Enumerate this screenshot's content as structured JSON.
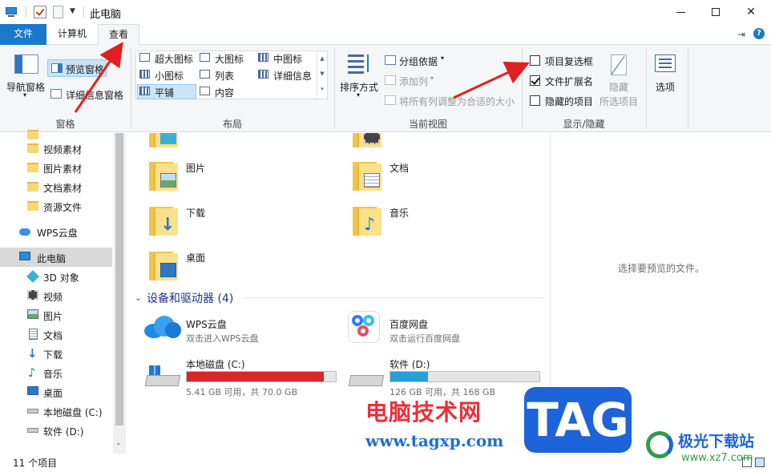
{
  "titlebar": {
    "title": "此电脑"
  },
  "tabs": {
    "file": "文件",
    "computer": "计算机",
    "view": "查看"
  },
  "ribbon": {
    "pane": {
      "group_label": "窗格",
      "nav_pane": "导航窗格",
      "preview_pane": "预览窗格",
      "details_pane": "详细信息窗格"
    },
    "layout": {
      "group_label": "布局",
      "options": [
        "超大图标",
        "大图标",
        "中图标",
        "小图标",
        "列表",
        "详细信息",
        "平铺",
        "内容"
      ],
      "selected": "平铺"
    },
    "current_view": {
      "group_label": "当前视图",
      "sort_by": "排序方式",
      "group_by": "分组依据",
      "add_column": "添加列",
      "size_all_columns": "将所有列调整为合适的大小"
    },
    "show_hide": {
      "group_label": "显示/隐藏",
      "item_checkboxes": {
        "label": "项目复选框",
        "checked": false
      },
      "file_extensions": {
        "label": "文件扩展名",
        "checked": true
      },
      "hidden_items": {
        "label": "隐藏的项目",
        "checked": false
      },
      "hide_selected_line1": "隐藏",
      "hide_selected_line2": "所选项目"
    },
    "options": "选项"
  },
  "nav_pane": {
    "items": [
      {
        "label": "视频素材",
        "icon": "folder-icon"
      },
      {
        "label": "图片素材",
        "icon": "folder-icon"
      },
      {
        "label": "文档素材",
        "icon": "folder-icon"
      },
      {
        "label": "资源文件",
        "icon": "folder-icon"
      },
      {
        "label": "WPS云盘",
        "icon": "cloud-icon"
      },
      {
        "label": "此电脑",
        "icon": "computer-icon",
        "selected": true
      },
      {
        "label": "3D 对象",
        "icon": "cube-icon"
      },
      {
        "label": "视频",
        "icon": "video-icon"
      },
      {
        "label": "图片",
        "icon": "picture-icon"
      },
      {
        "label": "文档",
        "icon": "document-icon"
      },
      {
        "label": "下载",
        "icon": "download-icon"
      },
      {
        "label": "音乐",
        "icon": "music-icon"
      },
      {
        "label": "桌面",
        "icon": "desktop-icon"
      },
      {
        "label": "本地磁盘 (C:)",
        "icon": "drive-icon"
      },
      {
        "label": "软件 (D:)",
        "icon": "drive-icon"
      }
    ]
  },
  "content": {
    "folders": [
      {
        "label": "图片"
      },
      {
        "label": "文档"
      },
      {
        "label": "下载"
      },
      {
        "label": "音乐"
      },
      {
        "label": "桌面"
      }
    ],
    "devices_header": "设备和驱动器 (4)",
    "devices": [
      {
        "label": "WPS云盘",
        "sub": "双击进入WPS云盘"
      },
      {
        "label": "百度网盘",
        "sub": "双击运行百度网盘"
      },
      {
        "label": "本地磁盘 (C:)",
        "sub": "5.41 GB 可用，共 70.0 GB",
        "used_fraction": 0.92,
        "bar_color": "#da2626"
      },
      {
        "label": "软件 (D:)",
        "sub": "126 GB 可用，共 168 GB",
        "used_fraction": 0.25,
        "bar_color": "#26a0da"
      }
    ]
  },
  "preview": {
    "message": "选择要预览的文件。"
  },
  "status": {
    "count": "11 个项目"
  },
  "watermark": {
    "site_name": "电脑技术网",
    "site_url": "www.tagxp.com",
    "tag": "TAG",
    "brand": "极光下载站",
    "brand_url": "www.xz7.com"
  },
  "colors": {
    "accent": "#1979ca",
    "selection": "#cce4f7",
    "arrow": "#e02020"
  }
}
